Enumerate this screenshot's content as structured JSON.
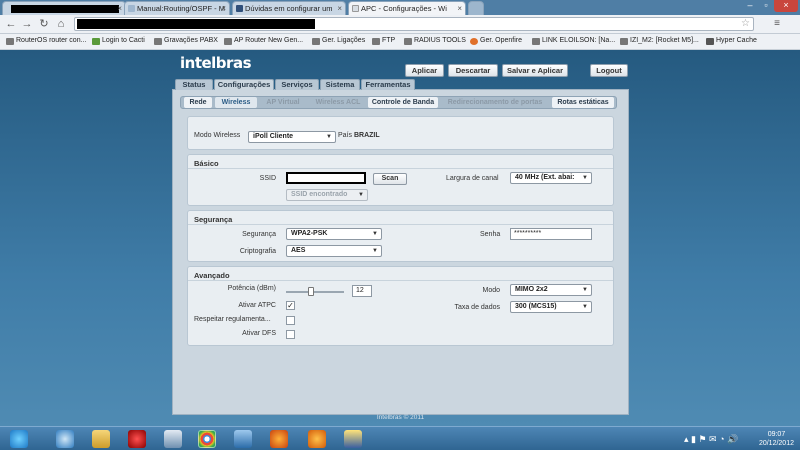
{
  "browser": {
    "tabs": [
      {
        "label": "",
        "masked": true
      },
      {
        "label": "Manual:Routing/OSPF - M"
      },
      {
        "label": "Dúvidas em configurar um"
      },
      {
        "label": "APC - Configurações - Wi"
      }
    ],
    "url": "",
    "bookmarks": [
      "RouterOS router con...",
      "Login to Cacti",
      "Gravações PABX",
      "AP Router New Gen...",
      "Ger. Ligações",
      "FTP",
      "RADIUS TOOLS",
      "Ger. Openfire",
      "LINK ELOILSON: [Na...",
      "IZI_M2: [Rocket M5]...",
      "Hyper Cache"
    ]
  },
  "header": {
    "brand": "intelbras",
    "buttons": {
      "apply": "Aplicar",
      "discard": "Descartar",
      "save_apply": "Salvar e Aplicar",
      "logout": "Logout"
    }
  },
  "main_tabs": [
    "Status",
    "Configurações",
    "Serviços",
    "Sistema",
    "Ferramentas"
  ],
  "sub_tabs": [
    "Rede",
    "Wireless",
    "AP Virtual",
    "Wireless ACL",
    "Controle de Banda",
    "Redirecionamento de portas",
    "Rotas estáticas"
  ],
  "wireless_mode": {
    "label": "Modo Wireless",
    "value": "iPoll Cliente",
    "country_label": "País",
    "country_value": "BRAZIL"
  },
  "basic": {
    "title": "Básico",
    "ssid_label": "SSID",
    "ssid_value": "",
    "scan_button": "Scan",
    "ssid_found": "SSID encontrado",
    "channel_width_label": "Largura de canal",
    "channel_width_value": "40 MHz (Ext. abai:"
  },
  "security": {
    "title": "Segurança",
    "security_label": "Segurança",
    "security_value": "WPA2-PSK",
    "password_label": "Senha",
    "password_value": "**********",
    "crypto_label": "Criptografia",
    "crypto_value": "AES"
  },
  "advanced": {
    "title": "Avançado",
    "power_label": "Potência (dBm)",
    "power_value": "12",
    "power_slider_fraction": 0.24,
    "atpc_label": "Ativar ATPC",
    "atpc_checked": true,
    "regulations_label": "Respeitar regulamenta...",
    "regulations_checked": false,
    "dfs_label": "Ativar DFS",
    "dfs_checked": false,
    "mode_label": "Modo",
    "mode_value": "MIMO 2x2",
    "rate_label": "Taxa de dados",
    "rate_value": "300 (MCS15)"
  },
  "footer": "Intelbras © 2011",
  "taskbar": {
    "time": "09:07",
    "date": "20/12/2012"
  }
}
